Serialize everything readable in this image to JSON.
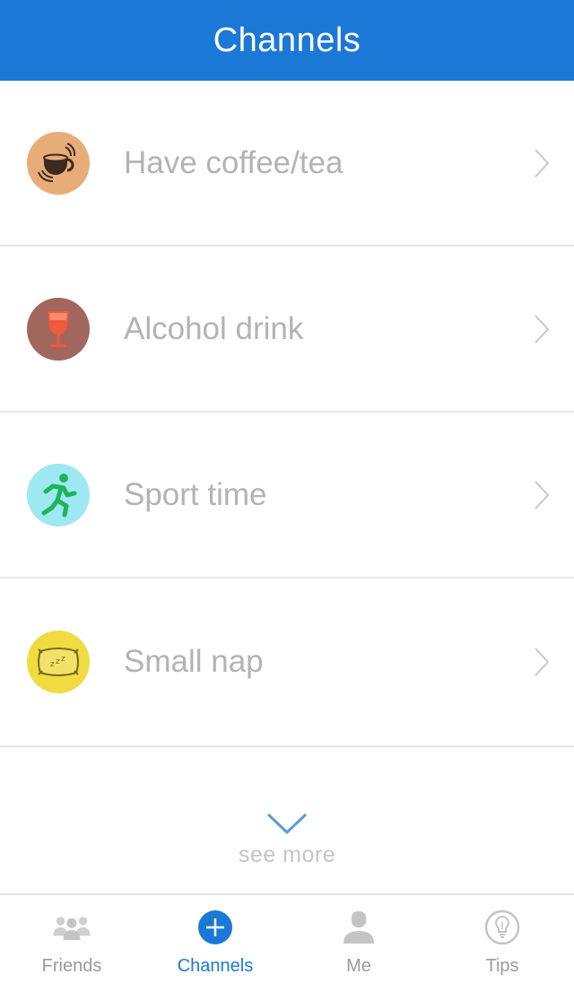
{
  "header": {
    "title": "Channels"
  },
  "channels": [
    {
      "label": "Have coffee/tea",
      "icon": "coffee-cup-icon",
      "color": "#e8ac78"
    },
    {
      "label": "Alcohol drink",
      "icon": "wine-glass-icon",
      "color": "#a1665d"
    },
    {
      "label": "Sport time",
      "icon": "running-person-icon",
      "color": "#9ee8f1"
    },
    {
      "label": "Small nap",
      "icon": "pillow-icon",
      "color": "#f0dc41"
    }
  ],
  "see_more": {
    "label": "see more"
  },
  "tabbar": {
    "tabs": [
      {
        "label": "Friends",
        "icon": "friends-icon",
        "active": false
      },
      {
        "label": "Channels",
        "icon": "plus-circle-icon",
        "active": true
      },
      {
        "label": "Me",
        "icon": "person-icon",
        "active": false
      },
      {
        "label": "Tips",
        "icon": "lightbulb-icon",
        "active": false
      }
    ]
  },
  "colors": {
    "accent": "#1c78d6",
    "label": "#b3b3b3",
    "inactive": "#9a9a9a"
  }
}
